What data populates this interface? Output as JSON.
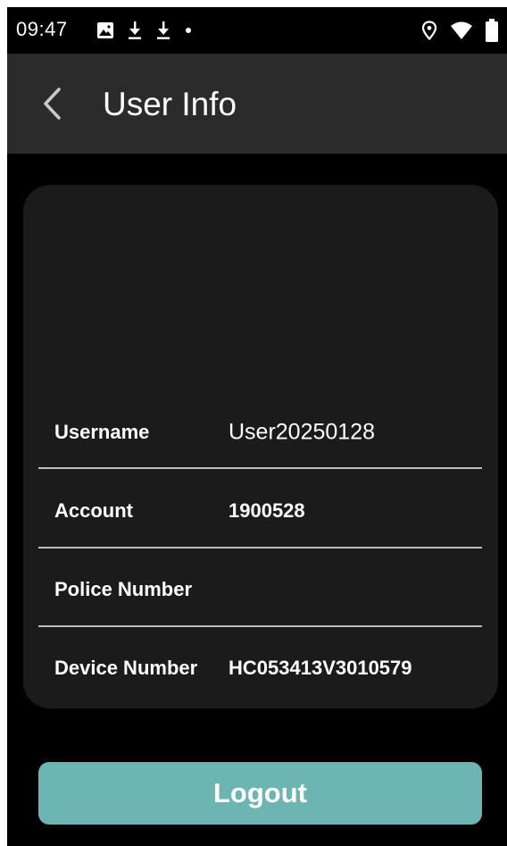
{
  "status_bar": {
    "time": "09:47",
    "left_icons": [
      "image-icon",
      "download-icon",
      "download-icon",
      "dot-icon"
    ],
    "right_icons": [
      "location-icon",
      "wifi-icon",
      "battery-icon"
    ]
  },
  "app_bar": {
    "back_icon": "chevron-left-icon",
    "title": "User Info"
  },
  "user_info": {
    "rows": [
      {
        "label": "Username",
        "value": "User20250128"
      },
      {
        "label": "Account",
        "value": "1900528"
      },
      {
        "label": "Police Number",
        "value": ""
      },
      {
        "label": "Device Number",
        "value": "HC053413V3010579"
      }
    ]
  },
  "actions": {
    "logout_label": "Logout"
  },
  "colors": {
    "background": "#000000",
    "app_bar": "#2b2b2b",
    "card": "#1b1b1b",
    "divider": "#bdbdbd",
    "logout_button": "#6cb5b3"
  }
}
